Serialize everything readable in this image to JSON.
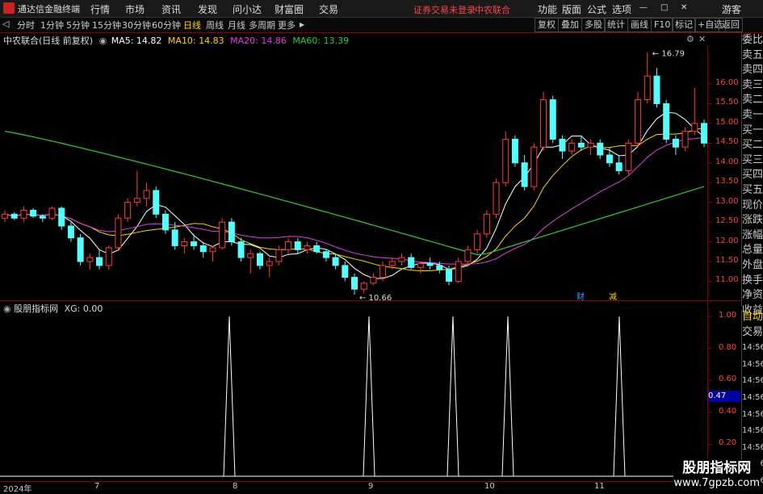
{
  "app": {
    "title": "通达信金融终端"
  },
  "menu": [
    "行情",
    "市场",
    "资讯",
    "发现",
    "问小达",
    "财富圈",
    "交易"
  ],
  "status": {
    "warning": "证券交易未登录",
    "stock": "中农联合"
  },
  "top_buttons": [
    "功能",
    "版面",
    "公式",
    "选项"
  ],
  "login": "游客",
  "periods": [
    "分时",
    "1分钟",
    "5分钟",
    "15分钟",
    "30分钟",
    "60分钟",
    "日线",
    "周线",
    "月线",
    "多周期",
    "更多"
  ],
  "active_period": "日线",
  "right_tools": [
    "复权",
    "叠加",
    "多股",
    "统计",
    "画线",
    "F10",
    "标记",
    "+自选",
    "返回"
  ],
  "chart_title": "中农联合(日线 前复权)",
  "ma": [
    {
      "label": "MA5: 14.82",
      "color": "#ffffff"
    },
    {
      "label": "MA10: 14.83",
      "color": "#ffd700"
    },
    {
      "label": "MA20: 14.86",
      "color": "#e040e0"
    },
    {
      "label": "MA60: 13.39",
      "color": "#33cc33"
    }
  ],
  "indicator": {
    "name": "股朋指标网",
    "value": "XG: 0.00"
  },
  "sidebar_top": [
    "委比",
    "卖五",
    "卖四",
    "卖三",
    "卖二",
    "卖一",
    "买一",
    "买二",
    "买三",
    "买四",
    "买五",
    "现价",
    "涨跌",
    "涨幅",
    "总量",
    "外盘",
    "换手",
    "净资",
    "收益"
  ],
  "sidebar_bottom": [
    "自动",
    "交易"
  ],
  "time_labels": [
    "14:56",
    "14:56",
    "14:56",
    "14:56",
    "14:56",
    "14:56",
    "14:56",
    "14:56",
    "14:56"
  ],
  "tape_value": "0.47",
  "markers": {
    "cai": "财",
    "jian": "减"
  },
  "watermark": {
    "line1": "股朋指标网",
    "line2": "www.7gpzb.com"
  },
  "chart_data": [
    {
      "type": "candlestick",
      "yticks": [
        "16.00",
        "15.50",
        "15.00",
        "14.50",
        "14.00",
        "13.50",
        "13.00",
        "12.50",
        "12.00",
        "11.50",
        "11.00"
      ],
      "ylim": [
        10.6,
        16.9
      ],
      "annotations": [
        {
          "text": "16.79",
          "price": 16.79
        },
        {
          "text": "10.66",
          "price": 10.66
        }
      ],
      "x_labels": [
        "2024年",
        "7",
        "8",
        "9",
        "10",
        "11"
      ],
      "candles": [
        [
          12.6,
          12.8,
          12.5,
          12.7
        ],
        [
          12.7,
          12.75,
          12.55,
          12.6
        ],
        [
          12.6,
          12.9,
          12.5,
          12.8
        ],
        [
          12.8,
          12.85,
          12.6,
          12.65
        ],
        [
          12.65,
          12.7,
          12.5,
          12.6
        ],
        [
          12.6,
          12.9,
          12.55,
          12.85
        ],
        [
          12.85,
          12.9,
          12.3,
          12.4
        ],
        [
          12.4,
          12.5,
          12.0,
          12.1
        ],
        [
          12.1,
          12.2,
          11.4,
          11.5
        ],
        [
          11.5,
          11.7,
          11.3,
          11.6
        ],
        [
          11.6,
          11.8,
          11.3,
          11.4
        ],
        [
          11.4,
          11.9,
          11.3,
          11.85
        ],
        [
          11.85,
          12.7,
          11.8,
          12.6
        ],
        [
          12.6,
          13.1,
          12.5,
          13.0
        ],
        [
          13.0,
          13.8,
          12.9,
          13.1
        ],
        [
          13.1,
          13.5,
          12.9,
          13.3
        ],
        [
          13.3,
          13.4,
          12.6,
          12.7
        ],
        [
          12.7,
          12.8,
          12.2,
          12.3
        ],
        [
          12.3,
          12.5,
          11.8,
          11.9
        ],
        [
          11.9,
          12.1,
          11.7,
          12.0
        ],
        [
          12.0,
          12.2,
          11.8,
          11.9
        ],
        [
          11.9,
          12.0,
          11.6,
          11.75
        ],
        [
          11.75,
          11.9,
          11.5,
          11.85
        ],
        [
          11.85,
          12.6,
          11.8,
          12.5
        ],
        [
          12.5,
          12.6,
          11.9,
          12.0
        ],
        [
          12.0,
          12.1,
          11.5,
          11.6
        ],
        [
          11.6,
          11.8,
          11.2,
          11.7
        ],
        [
          11.7,
          11.75,
          11.3,
          11.4
        ],
        [
          11.4,
          11.6,
          11.1,
          11.5
        ],
        [
          11.5,
          11.9,
          11.4,
          11.8
        ],
        [
          11.8,
          12.1,
          11.7,
          12.0
        ],
        [
          12.0,
          12.1,
          11.7,
          11.8
        ],
        [
          11.8,
          12.0,
          11.7,
          11.9
        ],
        [
          11.9,
          12.0,
          11.7,
          11.75
        ],
        [
          11.75,
          11.8,
          11.5,
          11.6
        ],
        [
          11.6,
          11.7,
          11.3,
          11.4
        ],
        [
          11.4,
          11.5,
          11.0,
          11.1
        ],
        [
          11.1,
          11.2,
          10.66,
          10.8
        ],
        [
          10.8,
          11.0,
          10.7,
          10.95
        ],
        [
          10.95,
          11.2,
          10.9,
          11.1
        ],
        [
          11.1,
          11.5,
          11.0,
          11.4
        ],
        [
          11.4,
          11.6,
          11.3,
          11.5
        ],
        [
          11.5,
          11.7,
          11.4,
          11.6
        ],
        [
          11.6,
          11.7,
          11.3,
          11.35
        ],
        [
          11.35,
          11.5,
          11.2,
          11.45
        ],
        [
          11.45,
          11.6,
          11.3,
          11.4
        ],
        [
          11.4,
          11.5,
          11.2,
          11.3
        ],
        [
          11.3,
          11.4,
          10.9,
          11.0
        ],
        [
          11.0,
          11.6,
          10.95,
          11.5
        ],
        [
          11.5,
          11.9,
          11.4,
          11.8
        ],
        [
          11.8,
          12.3,
          11.7,
          12.2
        ],
        [
          12.2,
          12.8,
          12.1,
          12.7
        ],
        [
          12.7,
          13.6,
          12.6,
          13.5
        ],
        [
          13.5,
          14.8,
          13.4,
          14.6
        ],
        [
          14.6,
          14.7,
          13.9,
          14.0
        ],
        [
          14.0,
          14.2,
          13.3,
          13.4
        ],
        [
          13.4,
          14.5,
          13.3,
          14.4
        ],
        [
          14.4,
          15.8,
          14.3,
          15.6
        ],
        [
          15.6,
          15.7,
          14.5,
          14.6
        ],
        [
          14.6,
          14.7,
          14.1,
          14.3
        ],
        [
          14.3,
          14.6,
          14.2,
          14.5
        ],
        [
          14.5,
          14.7,
          14.3,
          14.4
        ],
        [
          14.4,
          14.6,
          14.2,
          14.5
        ],
        [
          14.5,
          14.6,
          14.1,
          14.2
        ],
        [
          14.2,
          14.4,
          13.9,
          14.0
        ],
        [
          14.0,
          14.2,
          13.7,
          13.8
        ],
        [
          13.8,
          14.6,
          13.7,
          14.5
        ],
        [
          14.5,
          15.8,
          14.4,
          15.6
        ],
        [
          15.6,
          16.79,
          15.5,
          16.2
        ],
        [
          16.2,
          16.4,
          15.4,
          15.5
        ],
        [
          15.5,
          15.6,
          14.5,
          14.6
        ],
        [
          14.6,
          14.7,
          14.2,
          14.4
        ],
        [
          14.4,
          14.9,
          14.3,
          14.8
        ],
        [
          14.8,
          15.9,
          14.7,
          15.0
        ],
        [
          15.0,
          15.1,
          14.4,
          14.5
        ]
      ]
    },
    {
      "type": "line",
      "yticks": [
        "1.00",
        "0.80",
        "0.60",
        "0.40",
        "0.20"
      ],
      "ylim": [
        0,
        1
      ],
      "spikes_x": [
        284,
        457,
        561,
        629,
        767
      ]
    }
  ]
}
